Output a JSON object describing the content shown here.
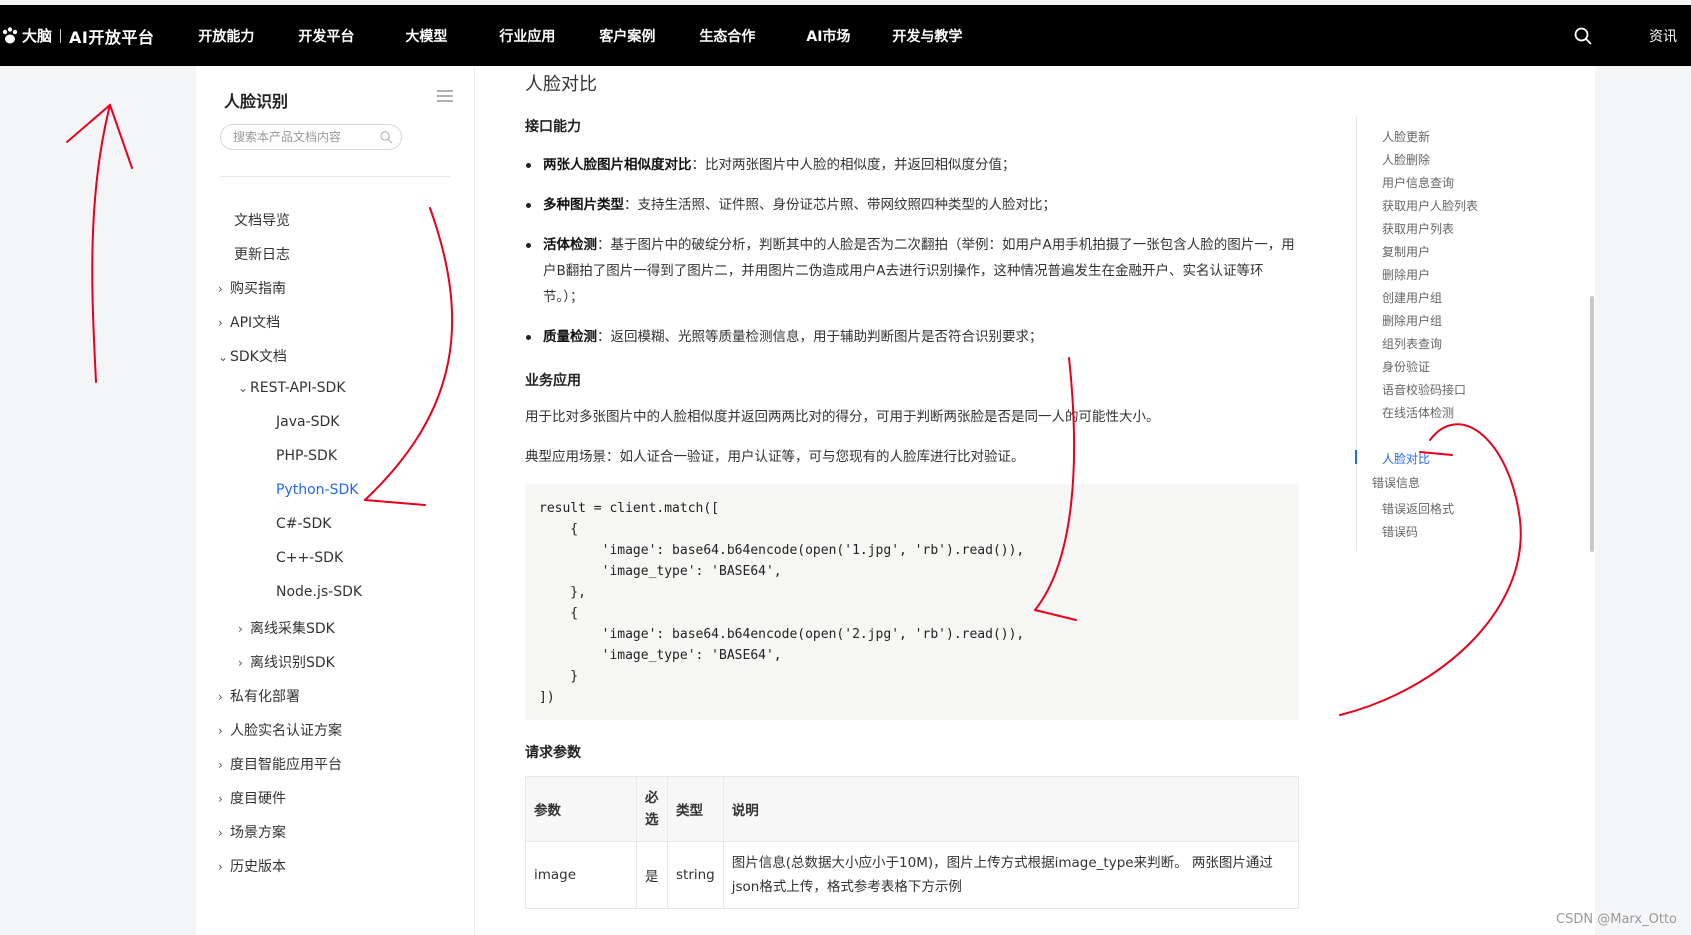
{
  "header": {
    "brand": "大脑",
    "platform": "AI开放平台",
    "nav": [
      "开放能力",
      "开发平台",
      "大模型",
      "行业应用",
      "客户案例",
      "生态合作",
      "AI市场",
      "开发与教学"
    ],
    "news": "资讯"
  },
  "sidebar": {
    "title": "人脸识别",
    "search_placeholder": "搜索本产品文档内容",
    "items": [
      {
        "label": "文档导览",
        "chevron": ""
      },
      {
        "label": "更新日志",
        "chevron": ""
      },
      {
        "label": "购买指南",
        "chevron": "›"
      },
      {
        "label": "API文档",
        "chevron": "›"
      },
      {
        "label": "SDK文档",
        "chevron": "⌄"
      },
      {
        "label": "REST-API-SDK",
        "chevron": "⌄"
      },
      {
        "label": "Java-SDK",
        "chevron": ""
      },
      {
        "label": "PHP-SDK",
        "chevron": ""
      },
      {
        "label": "Python-SDK",
        "chevron": ""
      },
      {
        "label": "C#-SDK",
        "chevron": ""
      },
      {
        "label": "C++-SDK",
        "chevron": ""
      },
      {
        "label": "Node.js-SDK",
        "chevron": ""
      },
      {
        "label": "离线采集SDK",
        "chevron": "›"
      },
      {
        "label": "离线识别SDK",
        "chevron": "›"
      },
      {
        "label": "私有化部署",
        "chevron": "›"
      },
      {
        "label": "人脸实名认证方案",
        "chevron": "›"
      },
      {
        "label": "度目智能应用平台",
        "chevron": "›"
      },
      {
        "label": "度目硬件",
        "chevron": "›"
      },
      {
        "label": "场景方案",
        "chevron": "›"
      },
      {
        "label": "历史版本",
        "chevron": "›"
      }
    ]
  },
  "main": {
    "page_title": "人脸对比",
    "section_capability": "接口能力",
    "bullets": [
      {
        "bold": "两张人脸图片相似度对比",
        "text": "：比对两张图片中人脸的相似度，并返回相似度分值；"
      },
      {
        "bold": "多种图片类型",
        "text": "：支持生活照、证件照、身份证芯片照、带网纹照四种类型的人脸对比；"
      },
      {
        "bold": "活体检测",
        "text": "：基于图片中的破绽分析，判断其中的人脸是否为二次翻拍（举例：如用户A用手机拍摄了一张包含人脸的图片一，用户B翻拍了图片一得到了图片二，并用图片二伪造成用户A去进行识别操作，这种情况普遍发生在金融开户、实名认证等环节。）；"
      },
      {
        "bold": "质量检测",
        "text": "：返回模糊、光照等质量检测信息，用于辅助判断图片是否符合识别要求；"
      }
    ],
    "section_business": "业务应用",
    "business_text": "用于比对多张图片中的人脸相似度并返回两两比对的得分，可用于判断两张脸是否是同一人的可能性大小。",
    "scenario_text": "典型应用场景：如人证合一验证，用户认证等，可与您现有的人脸库进行比对验证。",
    "code": "result = client.match([\n    {\n        'image': base64.b64encode(open('1.jpg', 'rb').read()),\n        'image_type': 'BASE64',\n    },\n    {\n        'image': base64.b64encode(open('2.jpg', 'rb').read()),\n        'image_type': 'BASE64',\n    }\n])",
    "section_params": "请求参数",
    "table": {
      "headers": [
        "参数",
        "必选",
        "类型",
        "说明"
      ],
      "rows": [
        [
          "image",
          "是",
          "string",
          "图片信息(总数据大小应小于10M)，图片上传方式根据image_type来判断。 两张图片通过json格式上传，格式参考表格下方示例"
        ]
      ]
    }
  },
  "toc": {
    "items": [
      "人脸更新",
      "人脸删除",
      "用户信息查询",
      "获取用户人脸列表",
      "获取用户列表",
      "复制用户",
      "删除用户",
      "创建用户组",
      "删除用户组",
      "组列表查询",
      "身份验证",
      "语音校验码接口",
      "在线活体检测",
      "人脸对比",
      "错误信息",
      "错误返回格式",
      "错误码"
    ],
    "active": "人脸对比"
  },
  "watermark": "CSDN @Marx_Otto",
  "colors": {
    "accent": "#2468f2",
    "annotation": "#e8001c",
    "topbar": "#000000"
  }
}
